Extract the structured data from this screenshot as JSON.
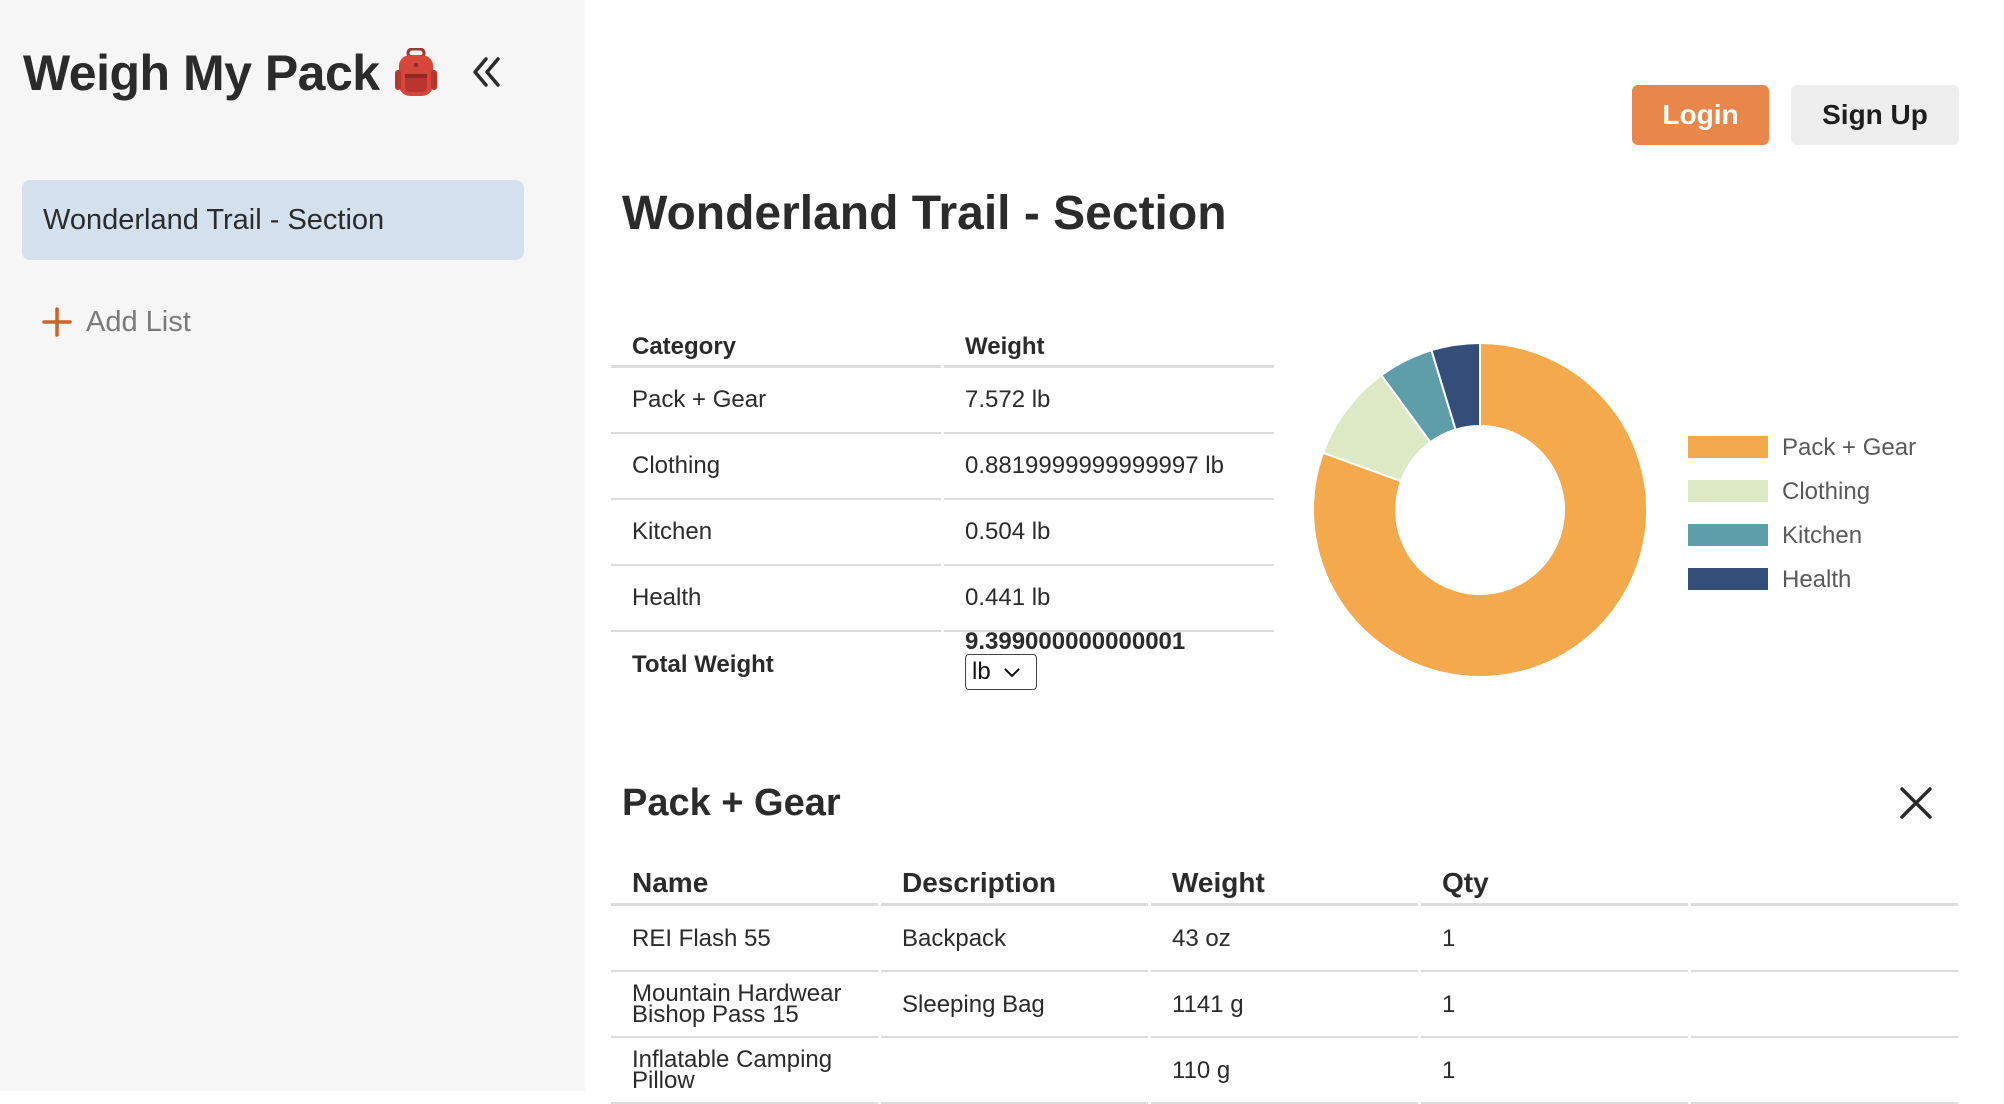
{
  "sidebar": {
    "app_title": "Weigh My Pack",
    "lists": [
      {
        "label": "Wonderland Trail - Section"
      }
    ],
    "add_list_label": "Add List"
  },
  "header": {
    "login_label": "Login",
    "signup_label": "Sign Up"
  },
  "page_title": "Wonderland Trail - Section",
  "summary": {
    "headers": [
      "Category",
      "Weight"
    ],
    "rows": [
      {
        "category": "Pack + Gear",
        "weight": "7.572 lb"
      },
      {
        "category": "Clothing",
        "weight": "0.8819999999999997 lb"
      },
      {
        "category": "Kitchen",
        "weight": "0.504 lb"
      },
      {
        "category": "Health",
        "weight": "0.441 lb"
      }
    ],
    "total_label": "Total Weight",
    "total_value": "9.399000000000001",
    "unit": "lb"
  },
  "chart_data": {
    "type": "pie",
    "style": "donut",
    "categories": [
      "Pack + Gear",
      "Clothing",
      "Kitchen",
      "Health"
    ],
    "values": [
      7.572,
      0.882,
      0.504,
      0.441
    ],
    "colors": [
      "#f4a94c",
      "#dde8c5",
      "#5e9ea8",
      "#324e79"
    ],
    "legend": "right"
  },
  "section": {
    "title": "Pack + Gear",
    "headers": [
      "Name",
      "Description",
      "Weight",
      "Qty",
      ""
    ],
    "rows": [
      {
        "name": "REI Flash 55",
        "description": "Backpack",
        "weight": "43 oz",
        "qty": "1"
      },
      {
        "name": "Mountain Hardwear Bishop Pass 15",
        "description": "Sleeping Bag",
        "weight": "1141 g",
        "qty": "1"
      },
      {
        "name": "Inflatable Camping Pillow",
        "description": "",
        "weight": "110 g",
        "qty": "1"
      }
    ]
  }
}
